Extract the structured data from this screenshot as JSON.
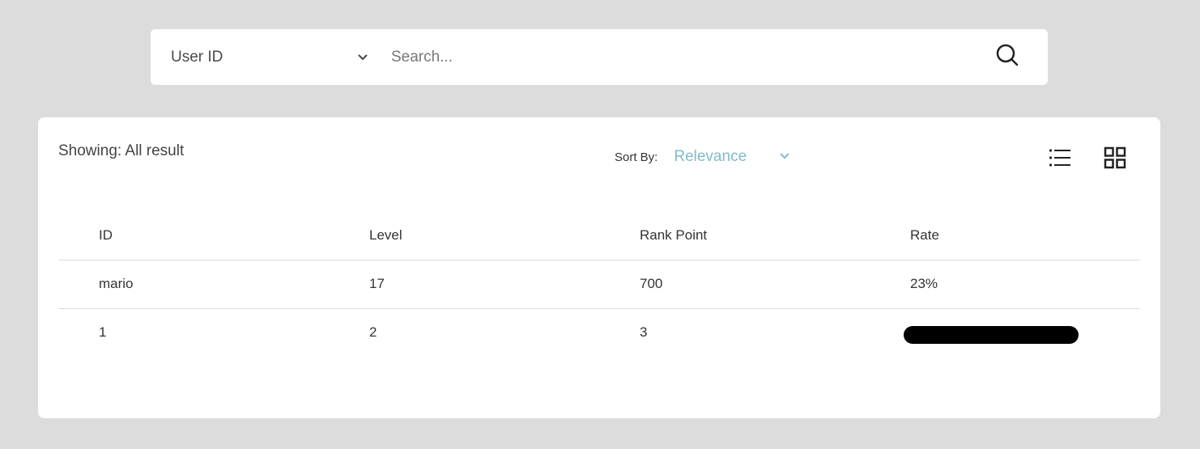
{
  "search": {
    "filter_selected": "User ID",
    "placeholder": "Search...",
    "value": ""
  },
  "results": {
    "showing_label": "Showing: All result",
    "sort_label": "Sort By:",
    "sort_selected": "Relevance"
  },
  "table": {
    "headers": [
      "ID",
      "Level",
      "Rank Point",
      "Rate"
    ],
    "rows": [
      [
        "mario",
        "17",
        "700",
        "23%"
      ],
      [
        "1",
        "2",
        "3",
        ""
      ]
    ]
  },
  "colors": {
    "background": "#dcdcdc",
    "accent": "#7fbccc"
  },
  "icons": [
    "chevron-down-icon",
    "search-icon",
    "list-view-icon",
    "grid-view-icon"
  ]
}
